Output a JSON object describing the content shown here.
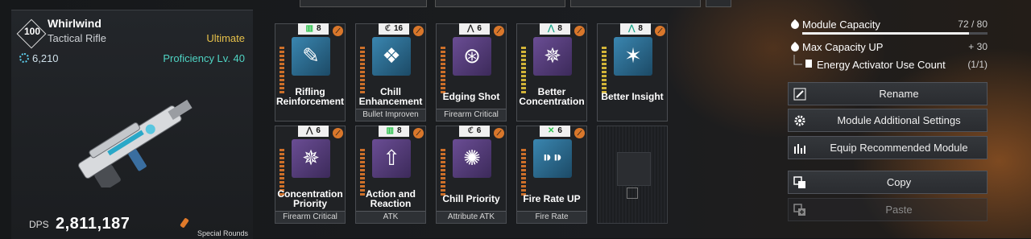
{
  "weapon": {
    "level": "100",
    "name": "Whirlwind",
    "type": "Tactical Rifle",
    "rarity": "Ultimate",
    "power": "6,210",
    "proficiency": "Proficiency Lv. 40",
    "dps_label": "DPS",
    "dps_value": "2,811,187",
    "ammo_type": "Special Rounds"
  },
  "modules": [
    {
      "name": "Rifling Reinforcement",
      "cost": "8",
      "socket": "green",
      "category": "",
      "icon": "bullet-wrench-icon"
    },
    {
      "name": "Chill Enhancement",
      "cost": "16",
      "socket": "chill",
      "category": "Bullet Improven",
      "icon": "ice-diamond-icon"
    },
    {
      "name": "Edging Shot",
      "cost": "6",
      "socket": "white",
      "category": "Firearm Critical",
      "icon": "crosshair-bullet-icon"
    },
    {
      "name": "Better Concentration",
      "cost": "8",
      "socket": "teal",
      "category": "",
      "icon": "star-burst-icon"
    },
    {
      "name": "Better Insight",
      "cost": "8",
      "socket": "teal",
      "category": "",
      "icon": "sparkle-arrow-icon"
    },
    {
      "name": "Concentration Priority",
      "cost": "6",
      "socket": "white",
      "category": "Firearm Critical",
      "icon": "star-burst-icon"
    },
    {
      "name": "Action and Reaction",
      "cost": "8",
      "socket": "green",
      "category": "ATK",
      "icon": "arrow-reaction-icon"
    },
    {
      "name": "Chill Priority",
      "cost": "6",
      "socket": "chill",
      "category": "Attribute ATK",
      "icon": "frost-burst-icon"
    },
    {
      "name": "Fire Rate UP",
      "cost": "6",
      "socket": "green-x",
      "category": "Fire Rate",
      "icon": "bullets-icon"
    }
  ],
  "capacity": {
    "label": "Module Capacity",
    "value": "72 / 80",
    "fraction": 0.9,
    "max_label": "Max Capacity UP",
    "max_value": "+ 30",
    "energy_label": "Energy Activator Use Count",
    "energy_value": "(1/1)"
  },
  "actions": {
    "rename": "Rename",
    "additional": "Module Additional Settings",
    "recommended": "Equip Recommended Module",
    "copy": "Copy",
    "paste": "Paste"
  }
}
